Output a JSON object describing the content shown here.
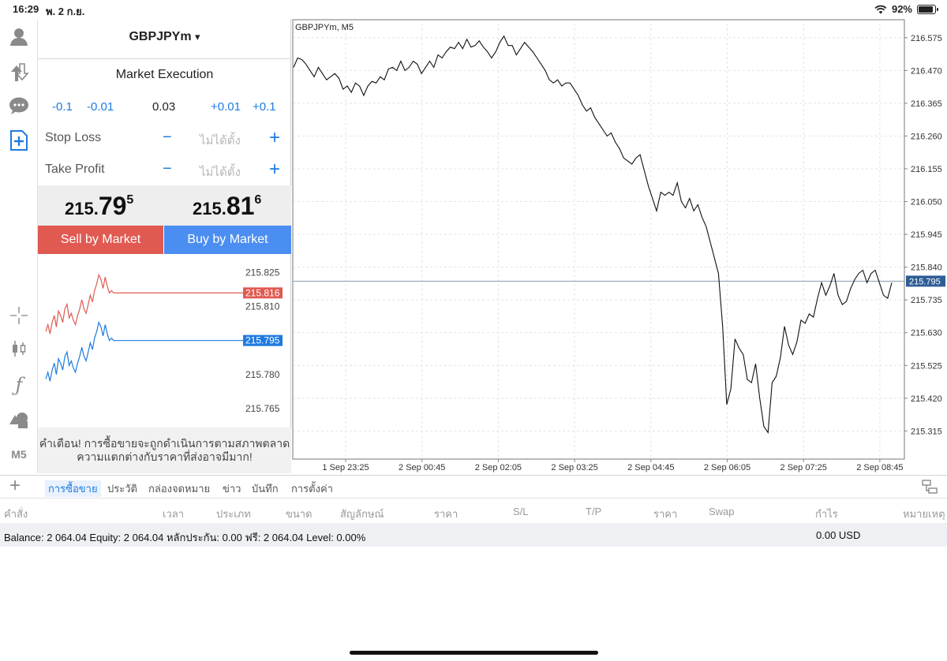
{
  "status": {
    "time": "16:29",
    "date": "พ. 2 ก.ย.",
    "battery": "92%",
    "battery_level": 0.92
  },
  "toolbar": {
    "icons": [
      "user-icon",
      "deposit-withdraw-icon",
      "chat-icon",
      "new-order-icon",
      "crosshair-icon",
      "candlestick-icon",
      "indicator-icon",
      "objects-icon"
    ],
    "timeframe": "M5"
  },
  "order": {
    "symbol": "GBPJPYm",
    "symbol_arrow": "▾",
    "execution": "Market Execution",
    "vol_minus_big": "-0.1",
    "vol_minus_small": "-0.01",
    "volume": "0.03",
    "vol_plus_small": "+0.01",
    "vol_plus_big": "+0.1",
    "stop_loss_label": "Stop Loss",
    "take_profit_label": "Take Profit",
    "not_set": "ไม่ได้ตั้ง",
    "minus": "−",
    "plus": "+",
    "sell_price": {
      "head": "215.",
      "big": "79",
      "tail": "5"
    },
    "buy_price": {
      "head": "215.",
      "big": "81",
      "tail": "6"
    },
    "sell_button": "Sell by Market",
    "buy_button": "Buy by Market",
    "warning_line1": "คำเตือน! การซื้อขายจะถูกดำเนินการตามสภาพตลาด",
    "warning_line2": "ความแตกต่างกับราคาที่ส่งอาจมีมาก!"
  },
  "mini_chart": {
    "y_ticks": [
      "215.825",
      "215.810",
      "215.780",
      "215.765"
    ],
    "ask_label": "215.816",
    "bid_label": "215.795",
    "ask_color": "#e05a52",
    "bid_color": "#1e7be0",
    "ylim": [
      215.758,
      215.829
    ],
    "ask_series": [
      215.799,
      215.802,
      215.798,
      215.803,
      215.806,
      215.801,
      215.808,
      215.806,
      215.803,
      215.809,
      215.811,
      215.805,
      215.807,
      215.804,
      215.802,
      215.806,
      215.809,
      215.813,
      215.809,
      215.807,
      215.811,
      215.815,
      215.812,
      215.817,
      215.82,
      215.824,
      215.822,
      215.818,
      215.823,
      215.819,
      215.816,
      215.817,
      215.816
    ],
    "bid_series": [
      215.778,
      215.781,
      215.777,
      215.782,
      215.785,
      215.78,
      215.787,
      215.785,
      215.782,
      215.788,
      215.79,
      215.784,
      215.786,
      215.783,
      215.781,
      215.785,
      215.788,
      215.792,
      215.788,
      215.786,
      215.79,
      215.794,
      215.791,
      215.796,
      215.799,
      215.803,
      215.801,
      215.797,
      215.802,
      215.798,
      215.795,
      215.796,
      215.795
    ]
  },
  "chart_data": {
    "type": "line",
    "title": "GBPJPYm, M5",
    "xlabel": "",
    "ylabel": "",
    "ylim": [
      215.225,
      216.62
    ],
    "y_ticks": [
      "216.575",
      "216.470",
      "216.365",
      "216.260",
      "216.155",
      "216.050",
      "215.945",
      "215.840",
      "215.735",
      "215.630",
      "215.525",
      "215.420",
      "215.315"
    ],
    "x_ticks": [
      "1 Sep 23:25",
      "2 Sep 00:45",
      "2 Sep 02:05",
      "2 Sep 03:25",
      "2 Sep 04:45",
      "2 Sep 06:05",
      "2 Sep 07:25",
      "2 Sep 08:45"
    ],
    "current_price_label": "215.795",
    "current_price": 215.795,
    "grid": true,
    "series": [
      {
        "values": [
          216.48,
          216.51,
          216.505,
          216.49,
          216.47,
          216.45,
          216.48,
          216.46,
          216.44,
          216.45,
          216.46,
          216.445,
          216.41,
          216.42,
          216.4,
          216.43,
          216.42,
          216.39,
          216.42,
          216.435,
          216.43,
          216.45,
          216.44,
          216.475,
          216.48,
          216.47,
          216.5,
          216.47,
          216.48,
          216.5,
          216.49,
          216.46,
          216.48,
          216.5,
          216.48,
          216.52,
          216.51,
          216.53,
          216.545,
          216.54,
          216.56,
          216.54,
          216.57,
          216.545,
          216.55,
          216.565,
          216.545,
          216.53,
          216.51,
          216.53,
          216.56,
          216.58,
          216.55,
          216.55,
          216.52,
          216.54,
          216.56,
          216.545,
          216.53,
          216.51,
          216.49,
          216.47,
          216.44,
          216.43,
          216.44,
          216.42,
          216.43,
          216.43,
          216.41,
          216.39,
          216.36,
          216.34,
          216.35,
          216.32,
          216.3,
          216.28,
          216.26,
          216.27,
          216.24,
          216.22,
          216.19,
          216.18,
          216.17,
          216.19,
          216.2,
          216.15,
          216.1,
          216.06,
          216.02,
          216.08,
          216.07,
          216.08,
          216.07,
          216.11,
          216.05,
          216.03,
          216.06,
          216.02,
          216.04,
          216.0,
          215.97,
          215.92,
          215.87,
          215.82,
          215.65,
          215.4,
          215.45,
          215.61,
          215.58,
          215.56,
          215.48,
          215.47,
          215.53,
          215.42,
          215.33,
          215.31,
          215.47,
          215.49,
          215.55,
          215.65,
          215.59,
          215.56,
          215.6,
          215.67,
          215.66,
          215.69,
          215.68,
          215.74,
          215.79,
          215.75,
          215.78,
          215.82,
          215.75,
          215.72,
          215.73,
          215.77,
          215.8,
          215.82,
          215.83,
          215.79,
          215.82,
          215.83,
          215.79,
          215.75,
          215.74,
          215.79
        ]
      }
    ]
  },
  "tabs": {
    "add": "+",
    "items": [
      "การซื้อขาย",
      "ประวัติ",
      "กล่องจดหมาย",
      "ข่าว",
      "บันทึก",
      "การตั้งค่า"
    ]
  },
  "columns": [
    "คำสั่ง",
    "เวลา",
    "ประเภท",
    "ขนาด",
    "สัญลักษณ์",
    "ราคา",
    "S/L",
    "T/P",
    "ราคา",
    "Swap",
    "กำไร",
    "หมายเหตุ"
  ],
  "account": {
    "summary": "Balance: 2 064.04 Equity: 2 064.04 หลักประกัน: 0.00 ฟรี: 2 064.04 Level: 0.00%",
    "profit": "0.00  USD"
  }
}
